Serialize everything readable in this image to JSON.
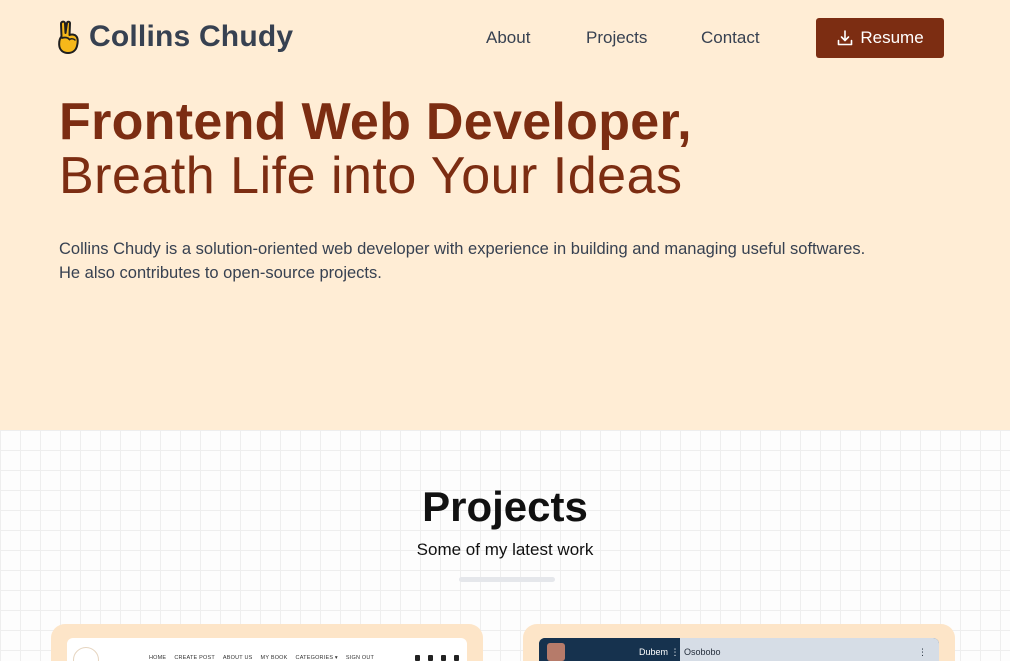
{
  "header": {
    "logo_text": "Collins Chudy",
    "logo_icon": "victory-hand-icon",
    "nav": [
      {
        "label": "About"
      },
      {
        "label": "Projects"
      },
      {
        "label": "Contact"
      }
    ],
    "resume_label": "Resume",
    "resume_icon": "download-icon"
  },
  "hero": {
    "headline": "Frontend Web Developer,",
    "subheadline": "Breath Life into Your Ideas",
    "bio_line1": "Collins Chudy is a solution-oriented web developer with experience in building and managing useful softwares.",
    "bio_line2": "He also contributes to open-source projects."
  },
  "projects": {
    "title": "Projects",
    "subtitle": "Some of my latest work",
    "cards": [
      {
        "preview_nav": [
          "HOME",
          "CREATE POST",
          "ABOUT US",
          "MY BOOK",
          "CATEGORIES ▾",
          "SIGN OUT"
        ]
      },
      {
        "preview_left_name": "Dubem",
        "preview_right_name": "Osobobo",
        "preview_menu": "⋮"
      }
    ]
  },
  "colors": {
    "hero_bg": "#ffedd5",
    "accent": "#7c2d12",
    "card_bg": "#fde5c8"
  }
}
